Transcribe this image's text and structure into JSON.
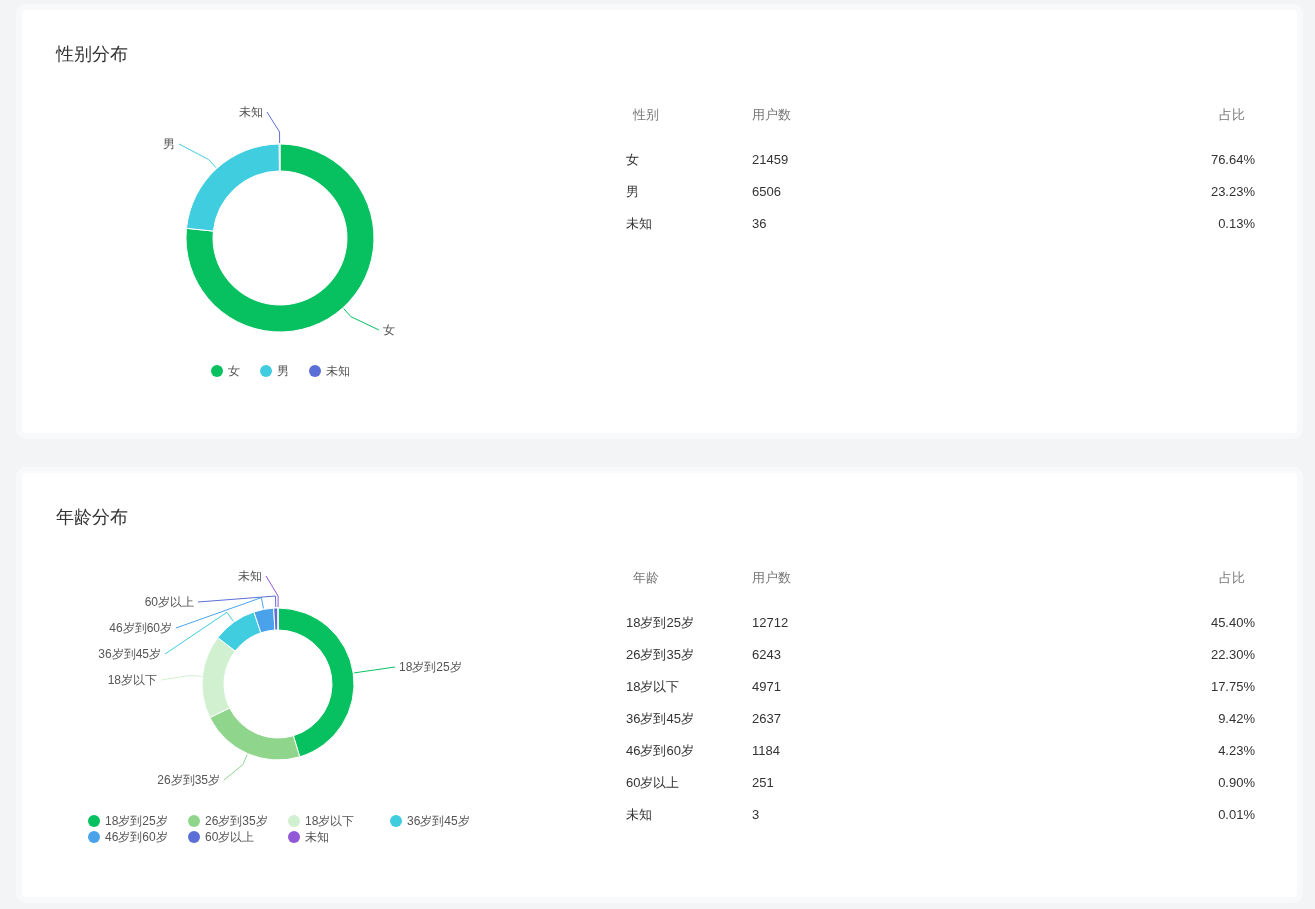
{
  "sections": [
    {
      "title": "性别分布",
      "chart_data": {
        "type": "donut",
        "categories": [
          "女",
          "男",
          "未知"
        ],
        "values": [
          76.64,
          23.23,
          0.13
        ]
      },
      "legend": [
        {
          "label": "女",
          "color": "#07c160"
        },
        {
          "label": "男",
          "color": "#40cde0"
        },
        {
          "label": "未知",
          "color": "#5b6fd6"
        }
      ],
      "table": {
        "columns": [
          "性别",
          "用户数",
          "占比"
        ],
        "rows": [
          [
            "女",
            "21459",
            "76.64%"
          ],
          [
            "男",
            "6506",
            "23.23%"
          ],
          [
            "未知",
            "36",
            "0.13%"
          ]
        ]
      }
    },
    {
      "title": "年龄分布",
      "chart_data": {
        "type": "donut",
        "categories": [
          "18岁到25岁",
          "26岁到35岁",
          "18岁以下",
          "36岁到45岁",
          "46岁到60岁",
          "60岁以上",
          "未知"
        ],
        "values": [
          45.4,
          22.3,
          17.75,
          9.42,
          4.23,
          0.9,
          0.01
        ]
      },
      "legend": [
        {
          "label": "18岁到25岁",
          "color": "#07c160"
        },
        {
          "label": "26岁到35岁",
          "color": "#8fd68c"
        },
        {
          "label": "18岁以下",
          "color": "#d0f0d0"
        },
        {
          "label": "36岁到45岁",
          "color": "#40cde0"
        },
        {
          "label": "46岁到60岁",
          "color": "#4aa3ea"
        },
        {
          "label": "60岁以上",
          "color": "#5b6fd6"
        },
        {
          "label": "未知",
          "color": "#9158d8"
        }
      ],
      "table": {
        "columns": [
          "年龄",
          "用户数",
          "占比"
        ],
        "rows": [
          [
            "18岁到25岁",
            "12712",
            "45.40%"
          ],
          [
            "26岁到35岁",
            "6243",
            "22.30%"
          ],
          [
            "18岁以下",
            "4971",
            "17.75%"
          ],
          [
            "36岁到45岁",
            "2637",
            "9.42%"
          ],
          [
            "46岁到60岁",
            "1184",
            "4.23%"
          ],
          [
            "60岁以上",
            "251",
            "0.90%"
          ],
          [
            "未知",
            "3",
            "0.01%"
          ]
        ]
      }
    }
  ]
}
